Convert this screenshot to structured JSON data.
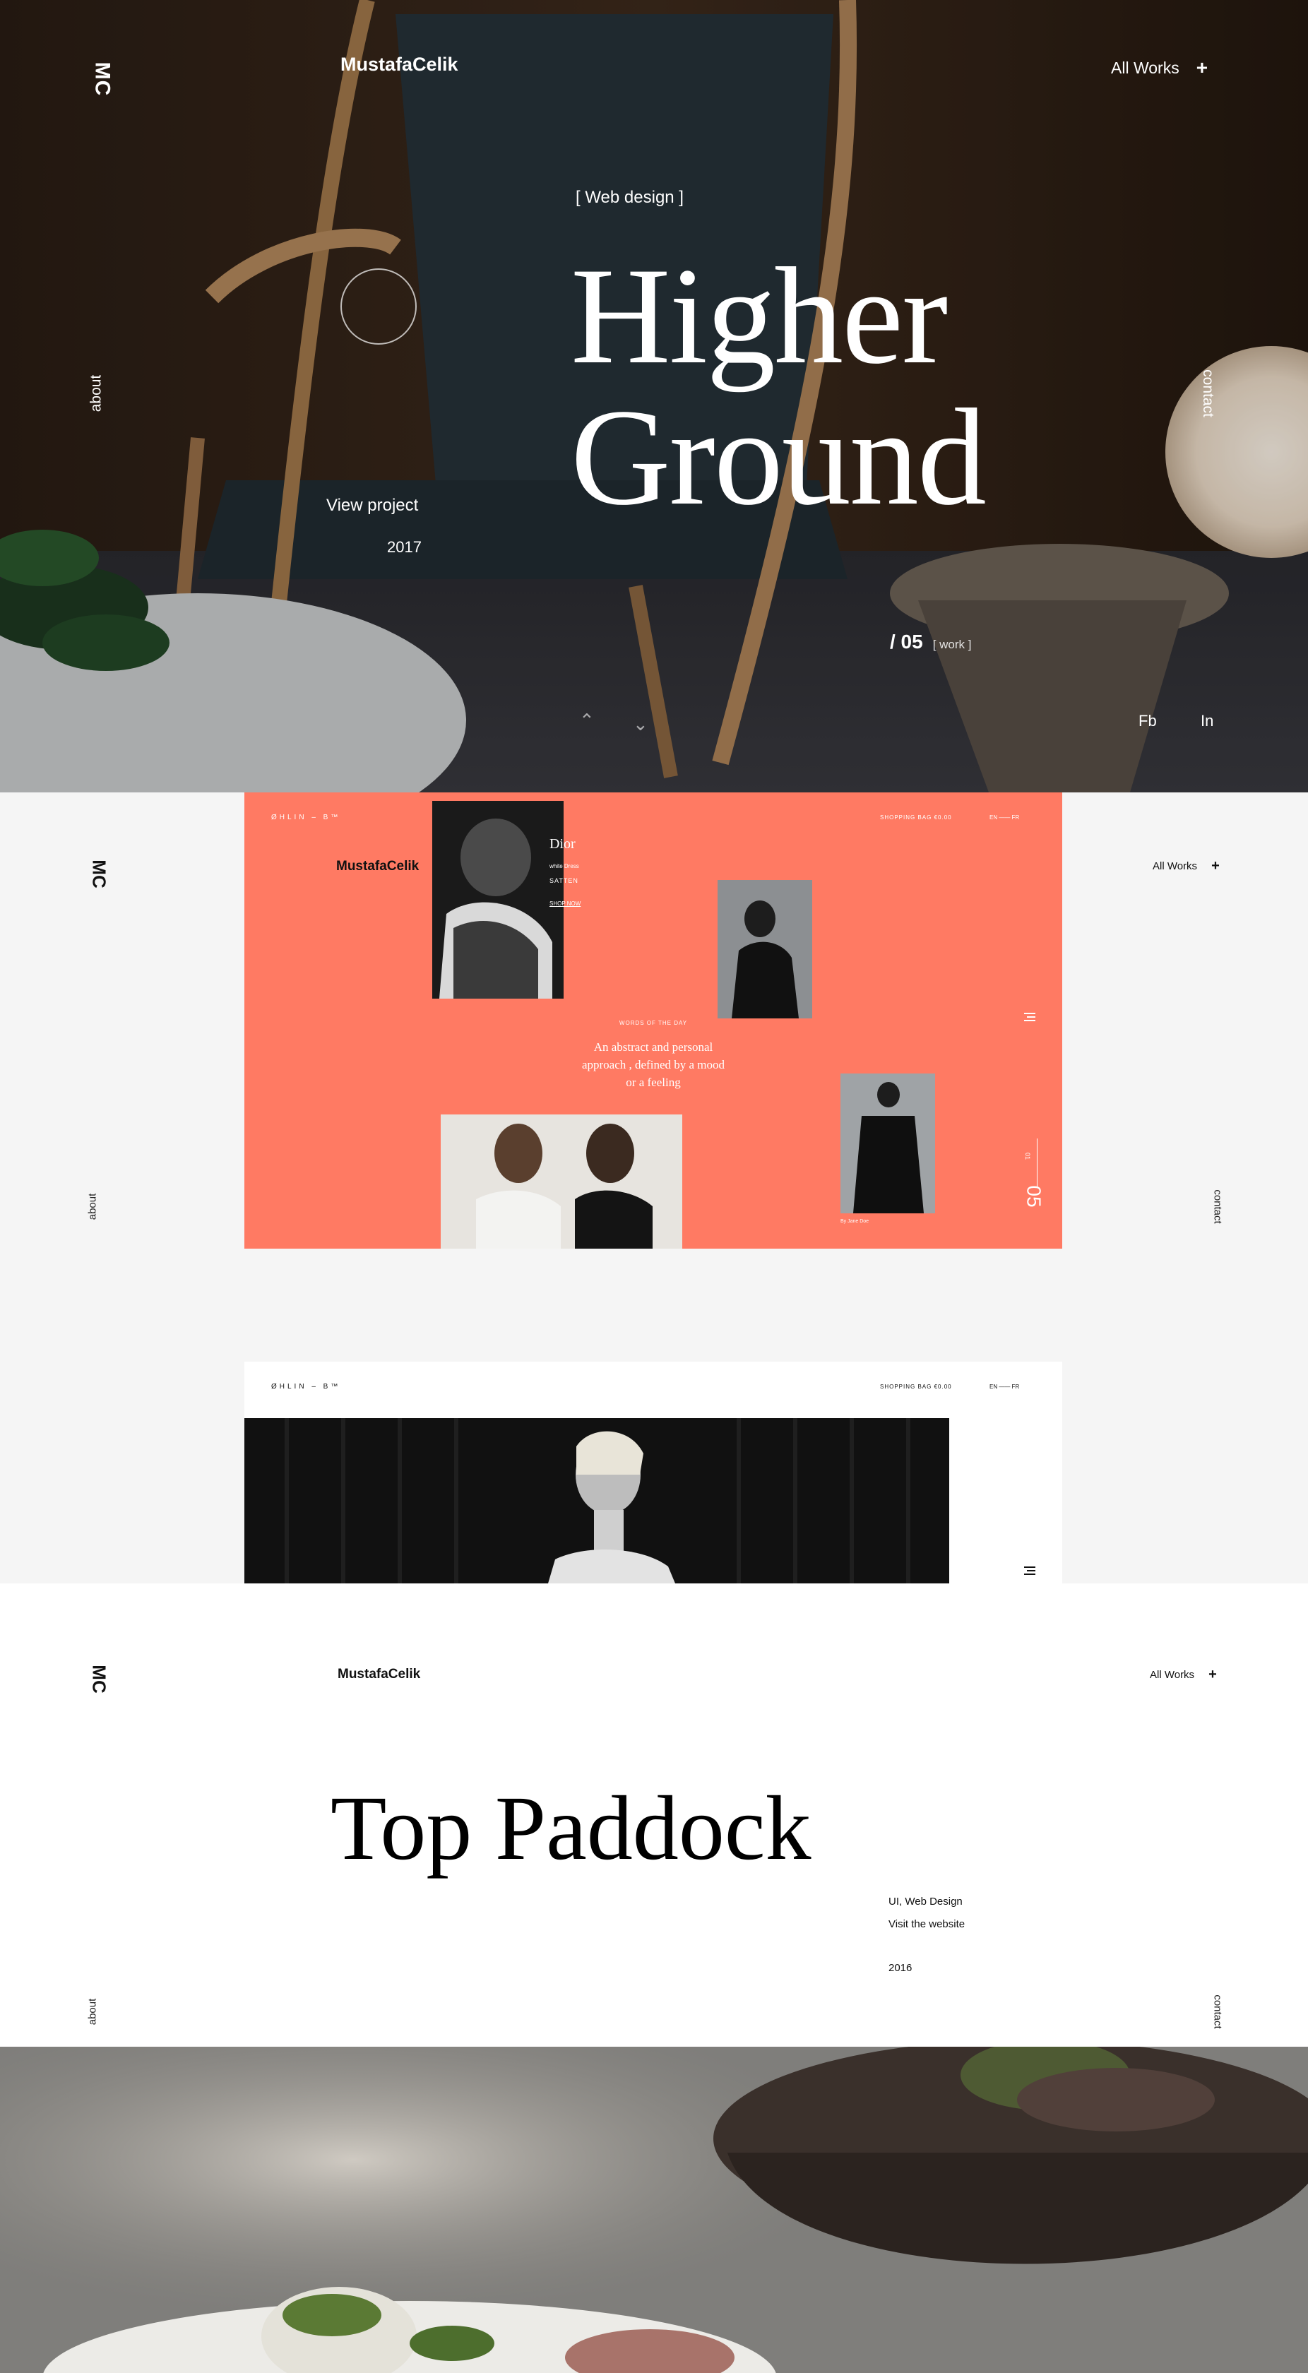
{
  "logo_mark": "MC",
  "brand": "MustafaCelik",
  "nav": {
    "all_works": "All Works",
    "plus": "+",
    "about": "about",
    "contact": "contact"
  },
  "hero": {
    "tag": "[ Web design ]",
    "title_line1": "Higher",
    "title_line2": "Ground",
    "view_project": "View project",
    "year": "2017",
    "counter": "/ 05",
    "counter_label": "[ work ]",
    "social": [
      "Fb",
      "In"
    ]
  },
  "ohlin": {
    "logo": "ØHLIN – B™",
    "shopping_bag": "SHOPPING BAG  €0.00",
    "lang": "EN  ——  FR",
    "dior_title": "Dior",
    "dior_sub1": "white Dress",
    "dior_sub2": "SATTEN",
    "shop_now": "SHOP NOW",
    "words_label": "WORDS OF THE DAY",
    "quote_line1": "An abstract and personal",
    "quote_line2": "approach , defined by a mood",
    "quote_line3": "or a feeling",
    "photo_credit": "By Jane Doe",
    "slide_small": "01",
    "slide_big": "05"
  },
  "ohlin2": {
    "logo": "ØHLIN – B™",
    "shopping_bag": "SHOPPING BAG  €0.00",
    "lang": "EN  ——  FR"
  },
  "paddock": {
    "title": "Top Paddock",
    "category": "UI, Web Design",
    "visit": "Visit the website",
    "year": "2016"
  },
  "colors": {
    "coral": "#FF7A63",
    "hero_bg": "#1a120c"
  }
}
